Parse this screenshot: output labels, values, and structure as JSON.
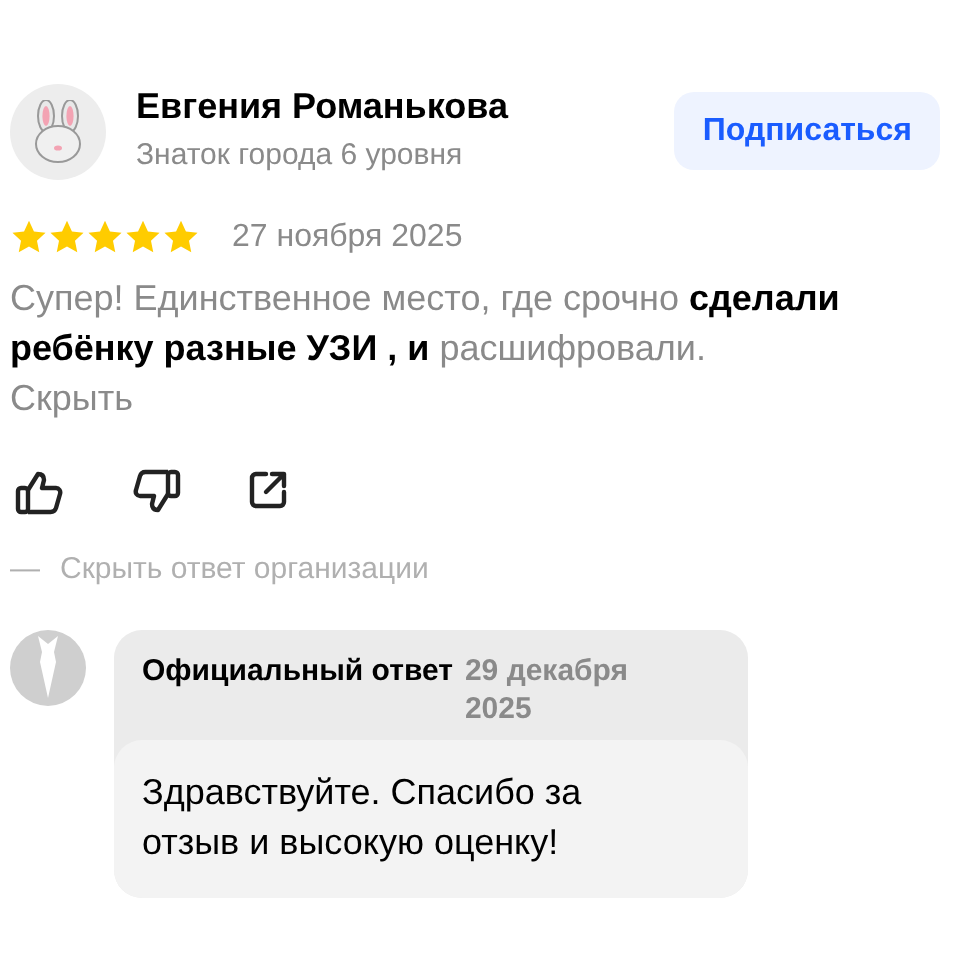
{
  "review": {
    "author": "Евгения Романькова",
    "author_level": "Знаток города 6 уровня",
    "subscribe_button": "Подписаться",
    "stars": 5,
    "date": "27 ноября 2025",
    "text": "Супер! Единственное место, где срочно **сделали ребёнку разные УЗИ , и** расшифровали.",
    "collapse_link": "Скрыть"
  },
  "reply_toggle": {
    "dash": "—",
    "label": "Скрыть ответ организации"
  },
  "official_reply": {
    "title": "Официальный ответ",
    "date": "29 декабря 2025",
    "text": "Здравствуйте. Спасибо за отзыв и высокую оценку!"
  }
}
